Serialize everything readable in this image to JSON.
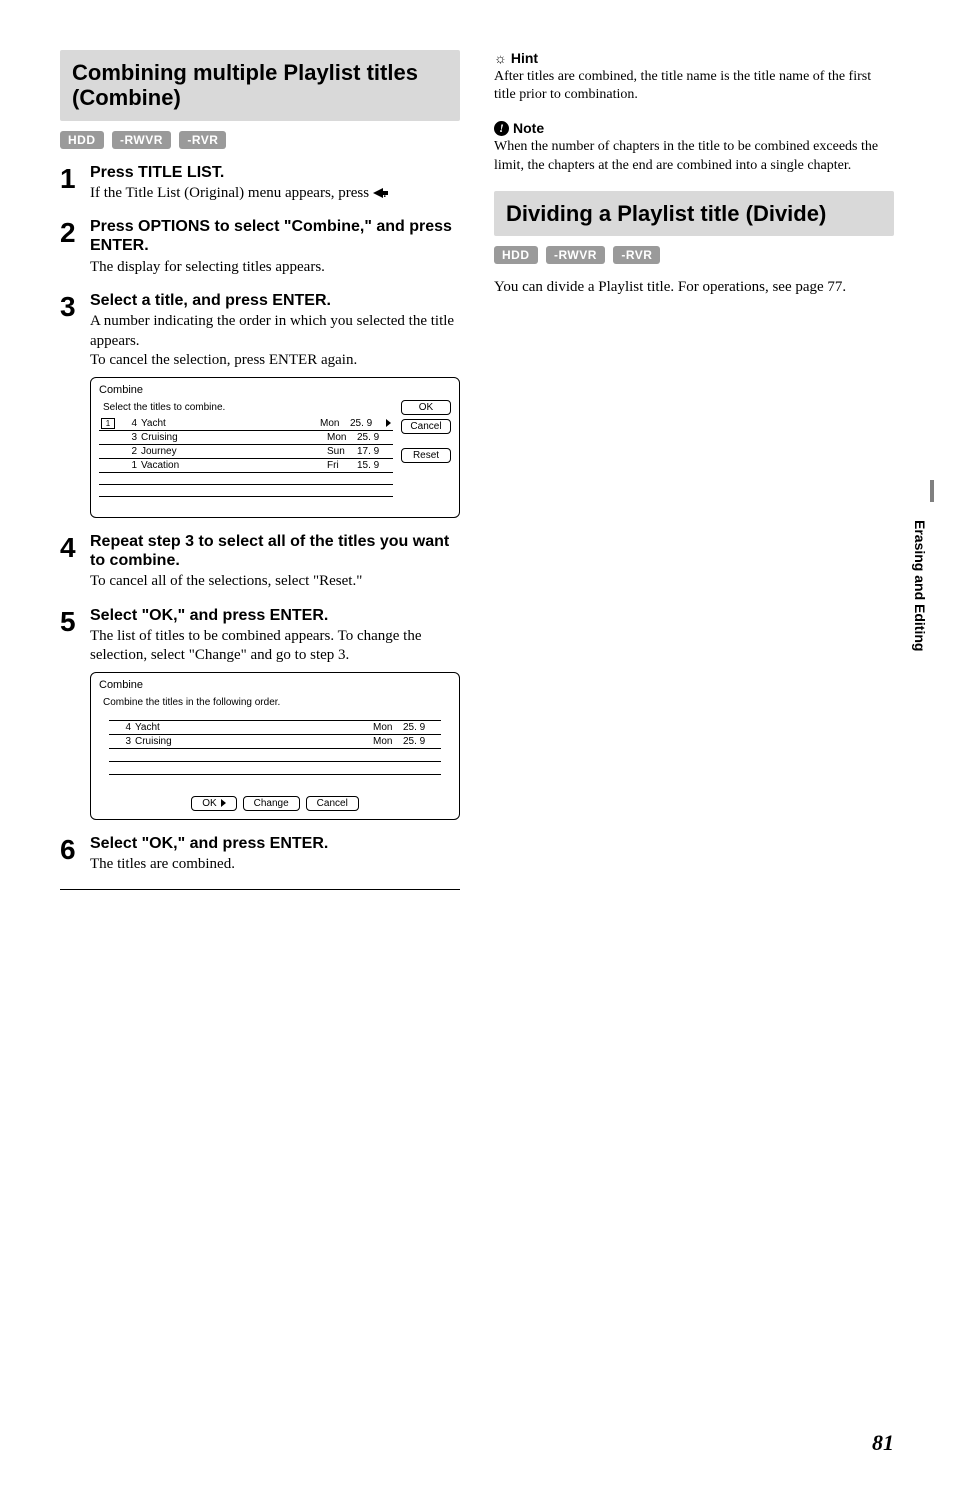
{
  "left": {
    "section_title": "Combining multiple Playlist titles (Combine)",
    "badges": [
      "HDD",
      "-RWVR",
      "-RVR"
    ],
    "steps": [
      {
        "num": "1",
        "title": "Press TITLE LIST.",
        "desc_parts": [
          "If the Title List (Original) menu appears, press ",
          "."
        ]
      },
      {
        "num": "2",
        "title": "Press OPTIONS to select \"Combine,\" and press ENTER.",
        "desc": "The display for selecting titles appears."
      },
      {
        "num": "3",
        "title": "Select a title, and press ENTER.",
        "desc": "A number indicating the order in which you selected the title appears.\nTo cancel the selection, press ENTER again."
      },
      {
        "num": "4",
        "title": "Repeat step 3 to select all of the titles you want to combine.",
        "desc": "To cancel all of the selections, select \"Reset.\""
      },
      {
        "num": "5",
        "title": "Select \"OK,\" and press ENTER.",
        "desc": "The list of titles to be combined appears. To change the selection, select \"Change\" and go to step 3."
      },
      {
        "num": "6",
        "title": "Select \"OK,\" and press ENTER.",
        "desc": "The titles are combined."
      }
    ],
    "dialog1": {
      "title": "Combine",
      "instruction": "Select the titles to combine.",
      "rows": [
        {
          "sel": "1",
          "num": "4",
          "title": "Yacht",
          "day": "Mon",
          "date": "25. 9",
          "scroll": true
        },
        {
          "sel": "",
          "num": "3",
          "title": "Cruising",
          "day": "Mon",
          "date": "25. 9"
        },
        {
          "sel": "",
          "num": "2",
          "title": "Journey",
          "day": "Sun",
          "date": "17. 9"
        },
        {
          "sel": "",
          "num": "1",
          "title": "Vacation",
          "day": "Fri",
          "date": "15. 9"
        }
      ],
      "buttons": [
        "OK",
        "Cancel",
        "Reset"
      ]
    },
    "dialog2": {
      "title": "Combine",
      "instruction": "Combine the titles in the following order.",
      "rows": [
        {
          "num": "4",
          "title": "Yacht",
          "day": "Mon",
          "date": "25. 9"
        },
        {
          "num": "3",
          "title": "Cruising",
          "day": "Mon",
          "date": "25. 9"
        }
      ],
      "buttons": [
        "OK",
        "Change",
        "Cancel"
      ]
    }
  },
  "right": {
    "hint_label": "Hint",
    "hint_text": "After titles are combined, the title name is the title name of the first title prior to combination.",
    "note_label": "Note",
    "note_text": "When the number of chapters in the title to be combined exceeds the limit, the chapters at the end are combined into a single chapter.",
    "section2_title": "Dividing a Playlist title (Divide)",
    "badges": [
      "HDD",
      "-RWVR",
      "-RVR"
    ],
    "body": "You can divide a Playlist title. For operations, see page 77."
  },
  "side_label": "Erasing and Editing",
  "page_number": "81"
}
